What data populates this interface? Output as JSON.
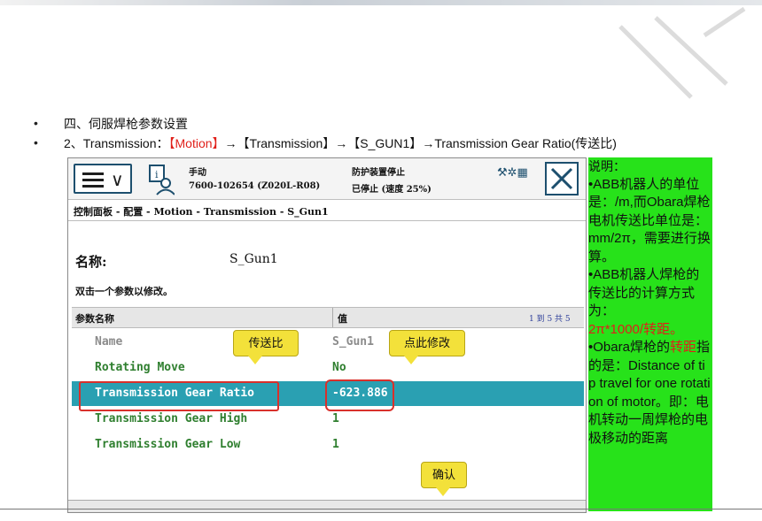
{
  "slide": {
    "line1": "四、伺服焊枪参数设置",
    "line2": {
      "prefix": "2、Transmission：",
      "motion": "【Motion】",
      "arrow1": "→【Transmission】",
      "arrow2": "→【S_GUN1】",
      "arrow3": "→Transmission Gear Ratio(传送比)"
    },
    "bullets": [
      "•",
      "•"
    ]
  },
  "flexpendant": {
    "status": {
      "mode": "手动",
      "controller": "7600-102654 (Z020L-R08)",
      "guard_state": "防护装置停止",
      "run_state": "已停止 (速度 25%)"
    },
    "breadcrumb": "控制面板 - 配置 - Motion - Transmission - S_Gun1",
    "name_label": "名称:",
    "name_value": "S_Gun1",
    "hint": "双击一个参数以修改。",
    "table": {
      "col_name": "参数名称",
      "col_value": "值",
      "paging": "1 到 5 共 5",
      "rows": [
        {
          "name": "Name",
          "value": "S_Gun1"
        },
        {
          "name": "Rotating Move",
          "value": "No"
        },
        {
          "name": "Transmission Gear Ratio",
          "value": "-623.886"
        },
        {
          "name": "Transmission Gear High",
          "value": "1"
        },
        {
          "name": "Transmission Gear Low",
          "value": "1"
        }
      ]
    },
    "icons": {
      "menu": "hamburger-menu-icon",
      "chevron": "chevron-down-icon",
      "user": "user-info-icon",
      "close": "close-icon",
      "tray": "status-tray-icons"
    }
  },
  "callouts": {
    "ratio": "传送比",
    "edit": "点此修改",
    "confirm": "确认"
  },
  "note": {
    "title": "说明：",
    "p1": "•ABB机器人的单位是：/m,而Obara焊枪电机传送比单位是：mm/2π，需要进行换算。",
    "p2a": "•ABB机器人焊枪的传送比的计算方式为：",
    "p2b": "2π*1000/转距。",
    "p3a": "•Obara焊枪的",
    "p3b": "转距",
    "p3c": "指的是：Distance of tip travel for one rotation of motor。即：电机转动一周焊枪的电极移动的距离"
  },
  "colors": {
    "note_bg": "#27e21a",
    "selected_row": "#2aa0b2",
    "accent_red": "#e0201a",
    "callout": "#f3e13a"
  }
}
